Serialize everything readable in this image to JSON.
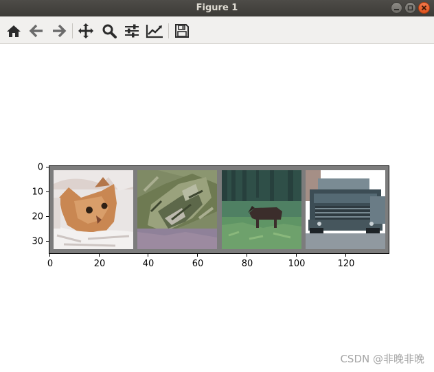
{
  "window": {
    "title": "Figure 1"
  },
  "toolbar": {
    "buttons": [
      {
        "name": "home-button",
        "icon": "home-icon"
      },
      {
        "name": "back-button",
        "icon": "arrow-left-icon"
      },
      {
        "name": "forward-button",
        "icon": "arrow-right-icon"
      },
      {
        "name": "pan-button",
        "icon": "move-icon"
      },
      {
        "name": "zoom-button",
        "icon": "magnifier-icon"
      },
      {
        "name": "subplots-button",
        "icon": "sliders-icon"
      },
      {
        "name": "edit-axes-button",
        "icon": "line-chart-icon"
      },
      {
        "name": "save-button",
        "icon": "floppy-disk-icon"
      }
    ]
  },
  "plot": {
    "x_ticks": [
      "0",
      "20",
      "40",
      "60",
      "80",
      "100",
      "120"
    ],
    "y_ticks": [
      "0",
      "10",
      "20",
      "30"
    ],
    "images": [
      {
        "subject": "cat"
      },
      {
        "subject": "frog"
      },
      {
        "subject": "deer"
      },
      {
        "subject": "truck"
      }
    ]
  },
  "watermark": "CSDN @非晚非晚"
}
